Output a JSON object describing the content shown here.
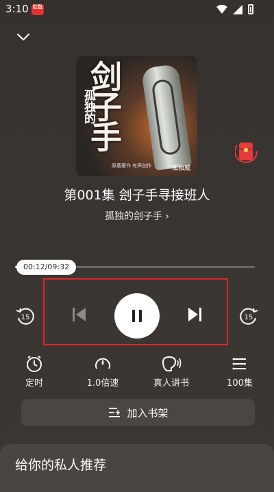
{
  "status_bar": {
    "time": "3:10",
    "app_badge": "红包\n天天领"
  },
  "player": {
    "cover": {
      "title_main": "剑子手",
      "title_sub": "孤独的",
      "author_text": "孤独威",
      "credits_text": "原著著作  有声创作"
    },
    "track_title": "第001集  刽子手寻接班人",
    "book_title": "孤独的刽子手 ›",
    "progress": {
      "time_label": "00:12/09:32",
      "fraction": 0.021
    },
    "controls": {
      "skip_back_label": "15",
      "skip_forward_label": "15"
    },
    "features": [
      {
        "label": "定时",
        "icon": "clock-icon"
      },
      {
        "label": "1.0倍速",
        "icon": "speed-icon"
      },
      {
        "label": "真人讲书",
        "icon": "voice-icon"
      },
      {
        "label": "100集",
        "icon": "playlist-icon"
      }
    ],
    "bookshelf_button": "加入书架"
  },
  "recommendation": {
    "title": "给你的私人推荐"
  },
  "colors": {
    "accent_highlight": "#e12525",
    "background": "#3a3532"
  }
}
